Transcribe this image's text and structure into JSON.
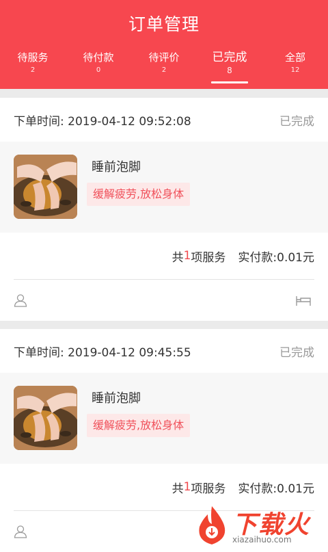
{
  "header": {
    "title": "订单管理",
    "tabs": [
      {
        "label": "待服务",
        "count": "2"
      },
      {
        "label": "待付款",
        "count": "0"
      },
      {
        "label": "待评价",
        "count": "2"
      },
      {
        "label": "已完成",
        "count": "8"
      },
      {
        "label": "全部",
        "count": "12"
      }
    ],
    "active_tab": "已完成"
  },
  "orders": [
    {
      "time_label": "下单时间:",
      "time": "2019-04-12 09:52:08",
      "status": "已完成",
      "service_name": "睡前泡脚",
      "service_tag": "缓解疲劳,放松身体",
      "sum_prefix": "共",
      "sum_count": "1",
      "sum_suffix": "项服务",
      "paid_label": "实付款:",
      "paid_amount": "0.01元",
      "icons": [
        "user-icon",
        "bed-icon"
      ]
    },
    {
      "time_label": "下单时间:",
      "time": "2019-04-12 09:45:55",
      "status": "已完成",
      "service_name": "睡前泡脚",
      "service_tag": "缓解疲劳,放松身体",
      "sum_prefix": "共",
      "sum_count": "1",
      "sum_suffix": "项服务",
      "paid_label": "实付款:",
      "paid_amount": "0.01元",
      "icons": [
        "user-icon"
      ]
    }
  ],
  "watermark": {
    "text": "下载火",
    "url": "xiazaihuo.com"
  },
  "colors": {
    "header": "#f7474f",
    "accent": "#f04a4f",
    "tag_bg": "#fde8e8"
  }
}
